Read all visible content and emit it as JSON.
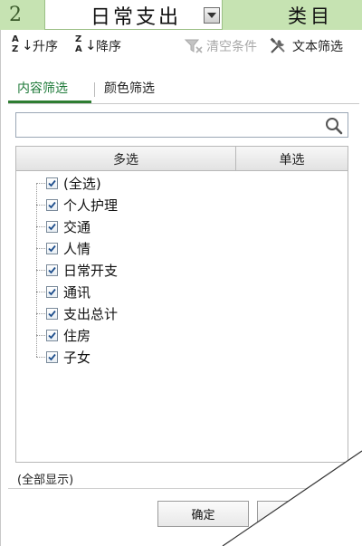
{
  "sheet": {
    "row_number": "2",
    "cell_a": "日常支出",
    "cell_b": "类目"
  },
  "toolbar": {
    "sort_asc_label": "升序",
    "sort_desc_label": "降序",
    "clear_label": "清空条件",
    "text_filter_label": "文本筛选",
    "sort_icon_letter_a": "A",
    "sort_icon_letter_z": "Z"
  },
  "tabs": {
    "content": "内容筛选",
    "color": "颜色筛选"
  },
  "search": {
    "value": "",
    "placeholder": ""
  },
  "list": {
    "header_multi": "多选",
    "header_single": "单选",
    "items": [
      {
        "label": "(全选)",
        "checked": true
      },
      {
        "label": "个人护理",
        "checked": true
      },
      {
        "label": "交通",
        "checked": true
      },
      {
        "label": "人情",
        "checked": true
      },
      {
        "label": "日常开支",
        "checked": true
      },
      {
        "label": "通讯",
        "checked": true
      },
      {
        "label": "支出总计",
        "checked": true
      },
      {
        "label": "住房",
        "checked": true
      },
      {
        "label": "子女",
        "checked": true
      }
    ]
  },
  "status": "(全部显示)",
  "buttons": {
    "ok": "确定",
    "cancel": ""
  },
  "colors": {
    "accent_green": "#2e7d32",
    "sheet_green": "#c6e3b2"
  }
}
